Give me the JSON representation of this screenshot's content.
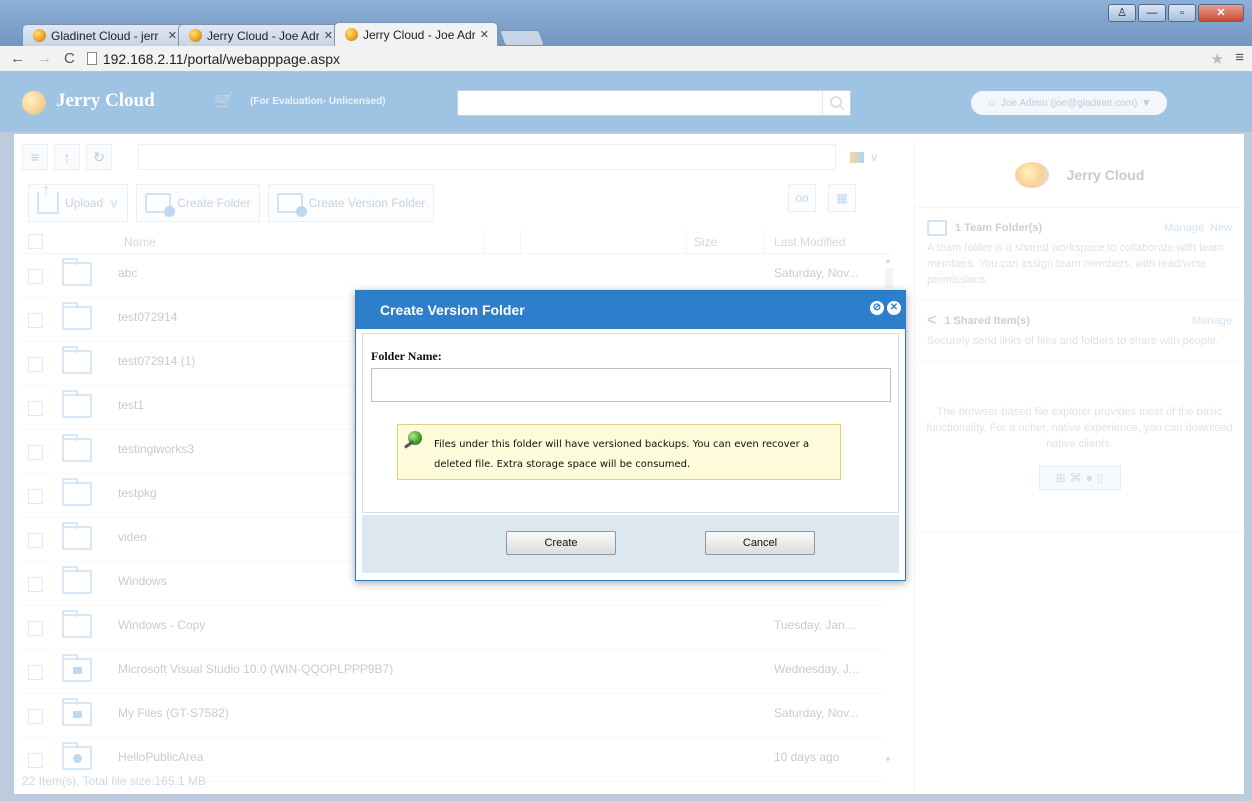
{
  "browser": {
    "tabs": [
      {
        "label": "Gladinet Cloud - jerr",
        "active": false
      },
      {
        "label": "Jerry Cloud - Joe Adr",
        "active": false
      },
      {
        "label": "Jerry Cloud - Joe Adr",
        "active": true
      }
    ],
    "url": "192.168.2.11/portal/webapppage.aspx"
  },
  "header": {
    "brand": "Jerry Cloud",
    "eval_note": "(For Evaluation- Unlicensed)",
    "search_value": "",
    "user": "Joe Admin (joe@gladinet.com)"
  },
  "toolbar": {
    "upload_label": "Upload",
    "create_folder_label": "Create Folder",
    "create_version_folder_label": "Create Version Folder"
  },
  "grid": {
    "headers": {
      "name": "Name",
      "size": "Size",
      "modified": "Last Modified"
    },
    "rows": [
      {
        "name": "abc",
        "modified": "Saturday, Nov...",
        "icon": "folder-icon"
      },
      {
        "name": "test072914",
        "modified": "",
        "icon": "folder-icon"
      },
      {
        "name": "test072914 (1)",
        "modified": "",
        "icon": "folder-icon"
      },
      {
        "name": "test1",
        "modified": "",
        "icon": "folder-icon"
      },
      {
        "name": "testingiworks3",
        "modified": "",
        "icon": "folder-icon"
      },
      {
        "name": "testpkg",
        "modified": "",
        "icon": "folder-icon"
      },
      {
        "name": "video",
        "modified": "",
        "icon": "folder-icon"
      },
      {
        "name": "Windows",
        "modified": "",
        "icon": "folder-icon"
      },
      {
        "name": "Windows - Copy",
        "modified": "Tuesday, Jan...",
        "icon": "folder-icon"
      },
      {
        "name": "Microsoft Visual Studio 10.0 (WIN-QQOPLPPP9B7)",
        "modified": "Wednesday, J...",
        "icon": "device-folder-icon"
      },
      {
        "name": "My Files (GT-S7582)",
        "modified": "Saturday, Nov...",
        "icon": "device-folder-icon"
      },
      {
        "name": "HelloPublicArea",
        "modified": "10 days ago",
        "icon": "public-folder-icon"
      }
    ],
    "footer": "22 Item(s), Total file size:165.1 MB"
  },
  "right_panel": {
    "title": "Jerry Cloud",
    "team": {
      "heading": "1 Team Folder(s)",
      "manage": "Manage",
      "new": "New",
      "desc": "A team folder is a shared workspace to collaborate with team members. You can assign team members, with read/write permissions."
    },
    "shared": {
      "heading": "1 Shared Item(s)",
      "manage": "Manage",
      "desc": "Securely send links of files and folders to share with people."
    },
    "clients_desc": "The browser-based file explorer provides most of the basic functionality. For a richer, native experience, you can download native clients."
  },
  "dialog": {
    "title": "Create Version Folder",
    "field_label": "Folder Name:",
    "field_value": "",
    "note": "Files under this folder will have versioned backups. You can even recover a deleted file. Extra storage space will be consumed.",
    "create_label": "Create",
    "cancel_label": "Cancel"
  },
  "colors": {
    "header_blue": "#2a7bc0",
    "dialog_blue": "#2d7fcb",
    "note_bg": "#fdfbd9"
  }
}
